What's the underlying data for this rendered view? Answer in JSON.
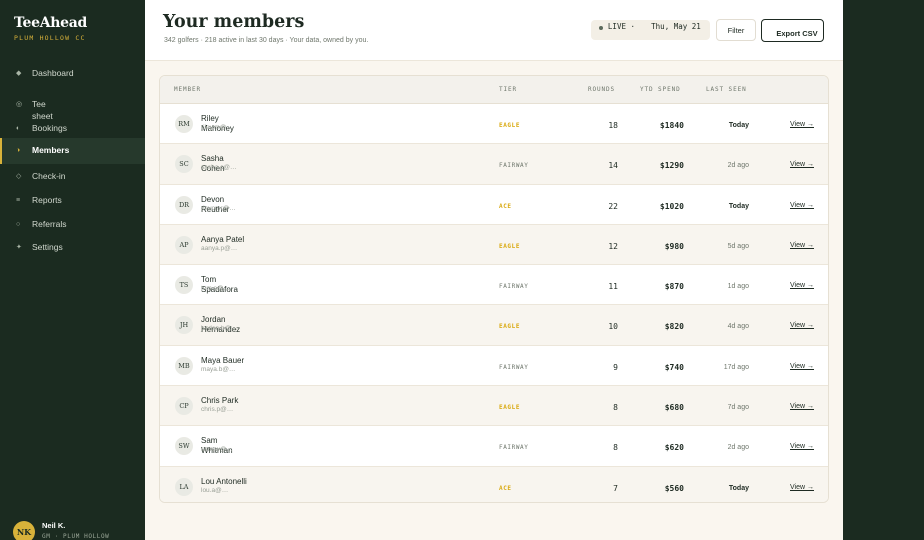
{
  "brand": {
    "name": "TeeAhead",
    "sub": "PLUM HOLLOW CC"
  },
  "nav": [
    {
      "label": "Dashboard",
      "icon": "diamond-icon",
      "glyph": "◆",
      "active": false
    },
    {
      "label": "Tee sheet",
      "icon": "circle-icon",
      "glyph": "◎",
      "active": false
    },
    {
      "label": "Bookings",
      "icon": "half-circle-icon",
      "glyph": "◐",
      "active": false
    },
    {
      "label": "Members",
      "icon": "half-circle-icon",
      "glyph": "◑",
      "active": true
    },
    {
      "label": "Check-in",
      "icon": "diamond-outline-icon",
      "glyph": "◇",
      "active": false
    },
    {
      "label": "Reports",
      "icon": "bars-icon",
      "glyph": "≡",
      "active": false
    },
    {
      "label": "Referrals",
      "icon": "ring-icon",
      "glyph": "○",
      "active": false
    },
    {
      "label": "Settings",
      "icon": "star-icon",
      "glyph": "✦",
      "active": false
    }
  ],
  "user": {
    "initials": "NK",
    "name": "Neil K.",
    "role": "GM · PLUM HOLLOW"
  },
  "header": {
    "title": "Your members",
    "subtitle": "342 golfers · 218 active in last 30 days · Your data, owned by you.",
    "live_label": "LIVE ·",
    "live_date": "Thu, May 21",
    "filter_label": "Filter",
    "export_label": "Export CSV"
  },
  "table": {
    "columns": {
      "member": "MEMBER",
      "tier": "TIER",
      "rounds": "ROUNDS",
      "spend": "YTD SPEND",
      "seen": "LAST SEEN"
    },
    "view_label": "View →",
    "rows": [
      {
        "initials": "RM",
        "name": "Riley Mahoney",
        "email": "riley.m@…",
        "tier": "EAGLE",
        "rounds": "18",
        "spend": "$1840",
        "seen": "Today"
      },
      {
        "initials": "SC",
        "name": "Sasha Cohen",
        "email": "sasha.c@…",
        "tier": "FAIRWAY",
        "rounds": "14",
        "spend": "$1290",
        "seen": "2d ago"
      },
      {
        "initials": "DR",
        "name": "Devon Reuther",
        "email": "devon.r@…",
        "tier": "ACE",
        "rounds": "22",
        "spend": "$1020",
        "seen": "Today"
      },
      {
        "initials": "AP",
        "name": "Aanya Patel",
        "email": "aanya.p@…",
        "tier": "EAGLE",
        "rounds": "12",
        "spend": "$980",
        "seen": "5d ago"
      },
      {
        "initials": "TS",
        "name": "Tom Spadafora",
        "email": "tom.s@…",
        "tier": "FAIRWAY",
        "rounds": "11",
        "spend": "$870",
        "seen": "1d ago"
      },
      {
        "initials": "JH",
        "name": "Jordan Hernandez",
        "email": "jordan.h@…",
        "tier": "EAGLE",
        "rounds": "10",
        "spend": "$820",
        "seen": "4d ago"
      },
      {
        "initials": "MB",
        "name": "Maya Bauer",
        "email": "maya.b@…",
        "tier": "FAIRWAY",
        "rounds": "9",
        "spend": "$740",
        "seen": "17d ago"
      },
      {
        "initials": "CP",
        "name": "Chris Park",
        "email": "chris.p@…",
        "tier": "EAGLE",
        "rounds": "8",
        "spend": "$680",
        "seen": "7d ago"
      },
      {
        "initials": "SW",
        "name": "Sam Whitman",
        "email": "sam.w@…",
        "tier": "FAIRWAY",
        "rounds": "8",
        "spend": "$620",
        "seen": "2d ago"
      },
      {
        "initials": "LA",
        "name": "Lou Antonelli",
        "email": "lou.a@…",
        "tier": "ACE",
        "rounds": "7",
        "spend": "$560",
        "seen": "Today"
      }
    ]
  },
  "colors": {
    "sidebar": "#1b2b20",
    "accent": "#d8b23a",
    "tier_gold": "#d9a90f",
    "page_bg": "#faf6ef"
  }
}
